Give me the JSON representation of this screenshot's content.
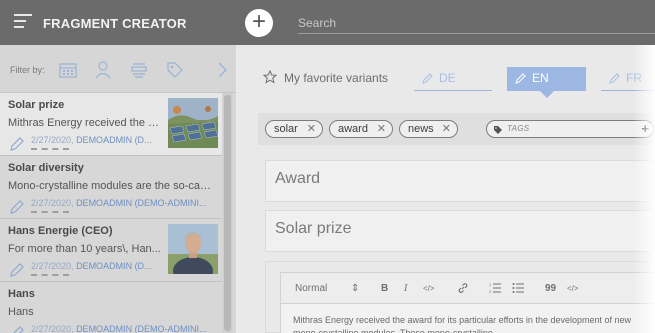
{
  "header": {
    "title": "FRAGMENT CREATOR",
    "add_label": "+",
    "search_placeholder": "Search"
  },
  "filter": {
    "label": "Filter by:",
    "icons": [
      "calendar-icon",
      "user-icon",
      "layout-icon",
      "tag-icon",
      "chevron-right-icon"
    ]
  },
  "list": [
    {
      "title": "Solar prize",
      "desc": "Mithras Energy received the a...",
      "date": "2/27/2020,",
      "author": "DEMOADMIN (D...",
      "thumb": "solar-field"
    },
    {
      "title": "Solar diversity",
      "desc": "Mono-crystalline modules are the so-calle...",
      "date": "2/27/2020,",
      "author": "DEMOADMIN (DEMO-ADMINI..."
    },
    {
      "title": "Hans Energie (CEO)",
      "desc": "For more than 10 years\\, Han...",
      "date": "2/27/2020,",
      "author": "DEMOADMIN (D...",
      "thumb": "portrait"
    },
    {
      "title": "Hans",
      "desc": "Hans",
      "date": "2/27/2020,",
      "author": "DEMOADMIN (DEMO-ADMINI..."
    }
  ],
  "right": {
    "favorites_label": "My favorite variants",
    "languages": [
      "DE",
      "EN",
      "FR"
    ],
    "active_language": "EN",
    "tags": [
      "solar",
      "award",
      "news"
    ],
    "tag_placeholder": "TAGS",
    "tag_add": "+",
    "field1": "Award",
    "field2": "Solar prize",
    "editor": {
      "style": "Normal",
      "style_arrow": "⇕",
      "bold": "B",
      "italic": "I",
      "code": "</>",
      "quote": "99",
      "code2": "</>",
      "content": "Mithras Energy received the award for its particular efforts in the development of new mono-crystalline modules. These mono-crystalline"
    }
  },
  "colors": {
    "topbar": "#6b6b6b",
    "accent": "#9cb8e2",
    "link": "#6e8fc2"
  }
}
